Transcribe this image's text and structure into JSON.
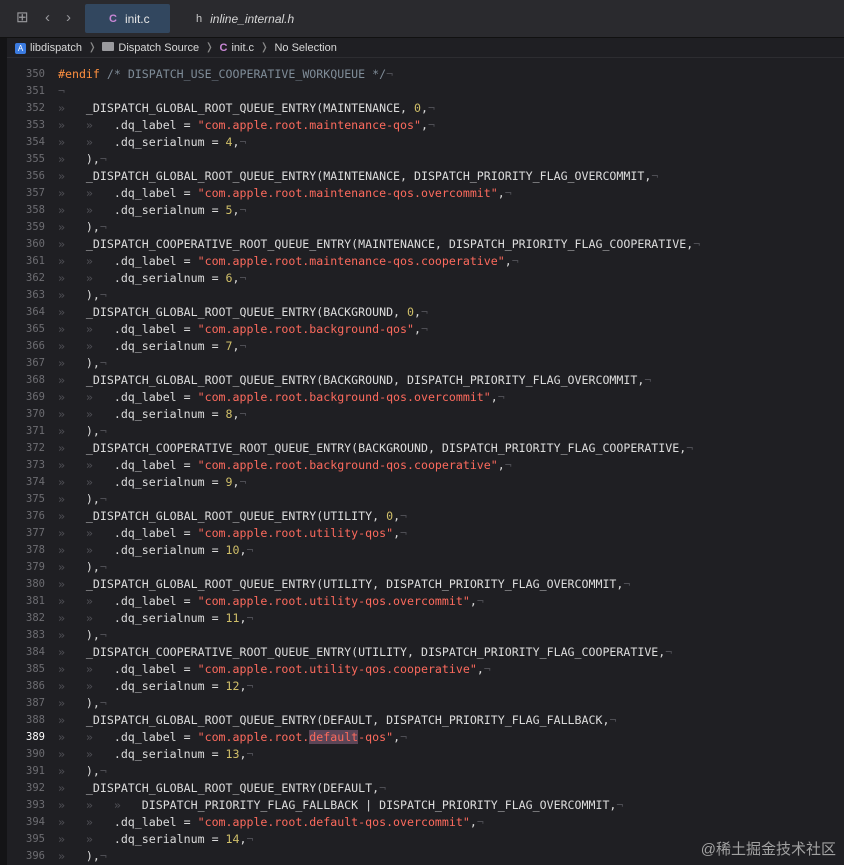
{
  "tabs": [
    {
      "icon": "C",
      "label": "init.c",
      "active": true
    },
    {
      "icon": "h",
      "label": "inline_internal.h",
      "active": false
    }
  ],
  "breadcrumbs": [
    {
      "icon": "xcode-project-icon",
      "label": "libdispatch"
    },
    {
      "icon": "folder-icon",
      "label": "Dispatch Source"
    },
    {
      "icon": "c-file-icon",
      "label": "init.c"
    },
    {
      "icon": "",
      "label": "No Selection"
    }
  ],
  "current_line": "389",
  "code_lines": [
    {
      "n": "350",
      "t": [
        [
          "kw",
          "#endif "
        ],
        [
          "cmt",
          "/* DISPATCH_USE_COOPERATIVE_WORKQUEUE */"
        ],
        [
          "eol",
          "¬"
        ]
      ]
    },
    {
      "n": "351",
      "t": [
        [
          "eol",
          "¬"
        ]
      ]
    },
    {
      "n": "352",
      "t": [
        [
          "tabm",
          "»   "
        ],
        [
          "plain",
          "_DISPATCH_GLOBAL_ROOT_QUEUE_ENTRY(MAINTENANCE, "
        ],
        [
          "num",
          "0"
        ],
        [
          "plain",
          ","
        ],
        [
          "eol",
          "¬"
        ]
      ]
    },
    {
      "n": "353",
      "t": [
        [
          "tabm",
          "»   »   "
        ],
        [
          "plain",
          ".dq_label = "
        ],
        [
          "str",
          "\"com.apple.root.maintenance-qos\""
        ],
        [
          "plain",
          ","
        ],
        [
          "eol",
          "¬"
        ]
      ]
    },
    {
      "n": "354",
      "t": [
        [
          "tabm",
          "»   »   "
        ],
        [
          "plain",
          ".dq_serialnum = "
        ],
        [
          "num",
          "4"
        ],
        [
          "plain",
          ","
        ],
        [
          "eol",
          "¬"
        ]
      ]
    },
    {
      "n": "355",
      "t": [
        [
          "tabm",
          "»   "
        ],
        [
          "plain",
          "),"
        ],
        [
          "eol",
          "¬"
        ]
      ]
    },
    {
      "n": "356",
      "t": [
        [
          "tabm",
          "»   "
        ],
        [
          "plain",
          "_DISPATCH_GLOBAL_ROOT_QUEUE_ENTRY(MAINTENANCE, DISPATCH_PRIORITY_FLAG_OVERCOMMIT,"
        ],
        [
          "eol",
          "¬"
        ]
      ]
    },
    {
      "n": "357",
      "t": [
        [
          "tabm",
          "»   »   "
        ],
        [
          "plain",
          ".dq_label = "
        ],
        [
          "str",
          "\"com.apple.root.maintenance-qos.overcommit\""
        ],
        [
          "plain",
          ","
        ],
        [
          "eol",
          "¬"
        ]
      ]
    },
    {
      "n": "358",
      "t": [
        [
          "tabm",
          "»   »   "
        ],
        [
          "plain",
          ".dq_serialnum = "
        ],
        [
          "num",
          "5"
        ],
        [
          "plain",
          ","
        ],
        [
          "eol",
          "¬"
        ]
      ]
    },
    {
      "n": "359",
      "t": [
        [
          "tabm",
          "»   "
        ],
        [
          "plain",
          "),"
        ],
        [
          "eol",
          "¬"
        ]
      ]
    },
    {
      "n": "360",
      "t": [
        [
          "tabm",
          "»   "
        ],
        [
          "plain",
          "_DISPATCH_COOPERATIVE_ROOT_QUEUE_ENTRY(MAINTENANCE, DISPATCH_PRIORITY_FLAG_COOPERATIVE,"
        ],
        [
          "eol",
          "¬"
        ]
      ]
    },
    {
      "n": "361",
      "t": [
        [
          "tabm",
          "»   »   "
        ],
        [
          "plain",
          ".dq_label = "
        ],
        [
          "str",
          "\"com.apple.root.maintenance-qos.cooperative\""
        ],
        [
          "plain",
          ","
        ],
        [
          "eol",
          "¬"
        ]
      ]
    },
    {
      "n": "362",
      "t": [
        [
          "tabm",
          "»   »   "
        ],
        [
          "plain",
          ".dq_serialnum = "
        ],
        [
          "num",
          "6"
        ],
        [
          "plain",
          ","
        ],
        [
          "eol",
          "¬"
        ]
      ]
    },
    {
      "n": "363",
      "t": [
        [
          "tabm",
          "»   "
        ],
        [
          "plain",
          "),"
        ],
        [
          "eol",
          "¬"
        ]
      ]
    },
    {
      "n": "364",
      "t": [
        [
          "tabm",
          "»   "
        ],
        [
          "plain",
          "_DISPATCH_GLOBAL_ROOT_QUEUE_ENTRY(BACKGROUND, "
        ],
        [
          "num",
          "0"
        ],
        [
          "plain",
          ","
        ],
        [
          "eol",
          "¬"
        ]
      ]
    },
    {
      "n": "365",
      "t": [
        [
          "tabm",
          "»   »   "
        ],
        [
          "plain",
          ".dq_label = "
        ],
        [
          "str",
          "\"com.apple.root.background-qos\""
        ],
        [
          "plain",
          ","
        ],
        [
          "eol",
          "¬"
        ]
      ]
    },
    {
      "n": "366",
      "t": [
        [
          "tabm",
          "»   »   "
        ],
        [
          "plain",
          ".dq_serialnum = "
        ],
        [
          "num",
          "7"
        ],
        [
          "plain",
          ","
        ],
        [
          "eol",
          "¬"
        ]
      ]
    },
    {
      "n": "367",
      "t": [
        [
          "tabm",
          "»   "
        ],
        [
          "plain",
          "),"
        ],
        [
          "eol",
          "¬"
        ]
      ]
    },
    {
      "n": "368",
      "t": [
        [
          "tabm",
          "»   "
        ],
        [
          "plain",
          "_DISPATCH_GLOBAL_ROOT_QUEUE_ENTRY(BACKGROUND, DISPATCH_PRIORITY_FLAG_OVERCOMMIT,"
        ],
        [
          "eol",
          "¬"
        ]
      ]
    },
    {
      "n": "369",
      "t": [
        [
          "tabm",
          "»   »   "
        ],
        [
          "plain",
          ".dq_label = "
        ],
        [
          "str",
          "\"com.apple.root.background-qos.overcommit\""
        ],
        [
          "plain",
          ","
        ],
        [
          "eol",
          "¬"
        ]
      ]
    },
    {
      "n": "370",
      "t": [
        [
          "tabm",
          "»   »   "
        ],
        [
          "plain",
          ".dq_serialnum = "
        ],
        [
          "num",
          "8"
        ],
        [
          "plain",
          ","
        ],
        [
          "eol",
          "¬"
        ]
      ]
    },
    {
      "n": "371",
      "t": [
        [
          "tabm",
          "»   "
        ],
        [
          "plain",
          "),"
        ],
        [
          "eol",
          "¬"
        ]
      ]
    },
    {
      "n": "372",
      "t": [
        [
          "tabm",
          "»   "
        ],
        [
          "plain",
          "_DISPATCH_COOPERATIVE_ROOT_QUEUE_ENTRY(BACKGROUND, DISPATCH_PRIORITY_FLAG_COOPERATIVE,"
        ],
        [
          "eol",
          "¬"
        ]
      ]
    },
    {
      "n": "373",
      "t": [
        [
          "tabm",
          "»   »   "
        ],
        [
          "plain",
          ".dq_label = "
        ],
        [
          "str",
          "\"com.apple.root.background-qos.cooperative\""
        ],
        [
          "plain",
          ","
        ],
        [
          "eol",
          "¬"
        ]
      ]
    },
    {
      "n": "374",
      "t": [
        [
          "tabm",
          "»   »   "
        ],
        [
          "plain",
          ".dq_serialnum = "
        ],
        [
          "num",
          "9"
        ],
        [
          "plain",
          ","
        ],
        [
          "eol",
          "¬"
        ]
      ]
    },
    {
      "n": "375",
      "t": [
        [
          "tabm",
          "»   "
        ],
        [
          "plain",
          "),"
        ],
        [
          "eol",
          "¬"
        ]
      ]
    },
    {
      "n": "376",
      "t": [
        [
          "tabm",
          "»   "
        ],
        [
          "plain",
          "_DISPATCH_GLOBAL_ROOT_QUEUE_ENTRY(UTILITY, "
        ],
        [
          "num",
          "0"
        ],
        [
          "plain",
          ","
        ],
        [
          "eol",
          "¬"
        ]
      ]
    },
    {
      "n": "377",
      "t": [
        [
          "tabm",
          "»   »   "
        ],
        [
          "plain",
          ".dq_label = "
        ],
        [
          "str",
          "\"com.apple.root.utility-qos\""
        ],
        [
          "plain",
          ","
        ],
        [
          "eol",
          "¬"
        ]
      ]
    },
    {
      "n": "378",
      "t": [
        [
          "tabm",
          "»   »   "
        ],
        [
          "plain",
          ".dq_serialnum = "
        ],
        [
          "num",
          "10"
        ],
        [
          "plain",
          ","
        ],
        [
          "eol",
          "¬"
        ]
      ]
    },
    {
      "n": "379",
      "t": [
        [
          "tabm",
          "»   "
        ],
        [
          "plain",
          "),"
        ],
        [
          "eol",
          "¬"
        ]
      ]
    },
    {
      "n": "380",
      "t": [
        [
          "tabm",
          "»   "
        ],
        [
          "plain",
          "_DISPATCH_GLOBAL_ROOT_QUEUE_ENTRY(UTILITY, DISPATCH_PRIORITY_FLAG_OVERCOMMIT,"
        ],
        [
          "eol",
          "¬"
        ]
      ]
    },
    {
      "n": "381",
      "t": [
        [
          "tabm",
          "»   »   "
        ],
        [
          "plain",
          ".dq_label = "
        ],
        [
          "str",
          "\"com.apple.root.utility-qos.overcommit\""
        ],
        [
          "plain",
          ","
        ],
        [
          "eol",
          "¬"
        ]
      ]
    },
    {
      "n": "382",
      "t": [
        [
          "tabm",
          "»   »   "
        ],
        [
          "plain",
          ".dq_serialnum = "
        ],
        [
          "num",
          "11"
        ],
        [
          "plain",
          ","
        ],
        [
          "eol",
          "¬"
        ]
      ]
    },
    {
      "n": "383",
      "t": [
        [
          "tabm",
          "»   "
        ],
        [
          "plain",
          "),"
        ],
        [
          "eol",
          "¬"
        ]
      ]
    },
    {
      "n": "384",
      "t": [
        [
          "tabm",
          "»   "
        ],
        [
          "plain",
          "_DISPATCH_COOPERATIVE_ROOT_QUEUE_ENTRY(UTILITY, DISPATCH_PRIORITY_FLAG_COOPERATIVE,"
        ],
        [
          "eol",
          "¬"
        ]
      ]
    },
    {
      "n": "385",
      "t": [
        [
          "tabm",
          "»   »   "
        ],
        [
          "plain",
          ".dq_label = "
        ],
        [
          "str",
          "\"com.apple.root.utility-qos.cooperative\""
        ],
        [
          "plain",
          ","
        ],
        [
          "eol",
          "¬"
        ]
      ]
    },
    {
      "n": "386",
      "t": [
        [
          "tabm",
          "»   »   "
        ],
        [
          "plain",
          ".dq_serialnum = "
        ],
        [
          "num",
          "12"
        ],
        [
          "plain",
          ","
        ],
        [
          "eol",
          "¬"
        ]
      ]
    },
    {
      "n": "387",
      "t": [
        [
          "tabm",
          "»   "
        ],
        [
          "plain",
          "),"
        ],
        [
          "eol",
          "¬"
        ]
      ]
    },
    {
      "n": "388",
      "t": [
        [
          "tabm",
          "»   "
        ],
        [
          "plain",
          "_DISPATCH_GLOBAL_ROOT_QUEUE_ENTRY(DEFAULT, DISPATCH_PRIORITY_FLAG_FALLBACK,"
        ],
        [
          "eol",
          "¬"
        ]
      ]
    },
    {
      "n": "389",
      "t": [
        [
          "tabm",
          "»   »   "
        ],
        [
          "plain",
          ".dq_label = "
        ],
        [
          "str",
          "\"com.apple.root."
        ],
        [
          "hl",
          "default"
        ],
        [
          "str",
          "-qos\""
        ],
        [
          "plain",
          ","
        ],
        [
          "eol",
          "¬"
        ]
      ]
    },
    {
      "n": "390",
      "t": [
        [
          "tabm",
          "»   »   "
        ],
        [
          "plain",
          ".dq_serialnum = "
        ],
        [
          "num",
          "13"
        ],
        [
          "plain",
          ","
        ],
        [
          "eol",
          "¬"
        ]
      ]
    },
    {
      "n": "391",
      "t": [
        [
          "tabm",
          "»   "
        ],
        [
          "plain",
          "),"
        ],
        [
          "eol",
          "¬"
        ]
      ]
    },
    {
      "n": "392",
      "t": [
        [
          "tabm",
          "»   "
        ],
        [
          "plain",
          "_DISPATCH_GLOBAL_ROOT_QUEUE_ENTRY(DEFAULT,"
        ],
        [
          "eol",
          "¬"
        ]
      ]
    },
    {
      "n": "393",
      "t": [
        [
          "tabm",
          "»   »   »   "
        ],
        [
          "plain",
          "DISPATCH_PRIORITY_FLAG_FALLBACK | DISPATCH_PRIORITY_FLAG_OVERCOMMIT,"
        ],
        [
          "eol",
          "¬"
        ]
      ]
    },
    {
      "n": "394",
      "t": [
        [
          "tabm",
          "»   »   "
        ],
        [
          "plain",
          ".dq_label = "
        ],
        [
          "str",
          "\"com.apple.root.default-qos.overcommit\""
        ],
        [
          "plain",
          ","
        ],
        [
          "eol",
          "¬"
        ]
      ]
    },
    {
      "n": "395",
      "t": [
        [
          "tabm",
          "»   »   "
        ],
        [
          "plain",
          ".dq_serialnum = "
        ],
        [
          "num",
          "14"
        ],
        [
          "plain",
          ","
        ],
        [
          "eol",
          "¬"
        ]
      ]
    },
    {
      "n": "396",
      "t": [
        [
          "tabm",
          "»   "
        ],
        [
          "plain",
          "),"
        ],
        [
          "eol",
          "¬"
        ]
      ]
    }
  ],
  "watermark": "@稀土掘金技术社区",
  "colors": {
    "string": "#fc6a5d",
    "number": "#d0bf69",
    "comment": "#7f8c98",
    "preprocessor": "#fd8f3f",
    "plain": "#dcdcdc",
    "highlight": "#5c4557"
  }
}
